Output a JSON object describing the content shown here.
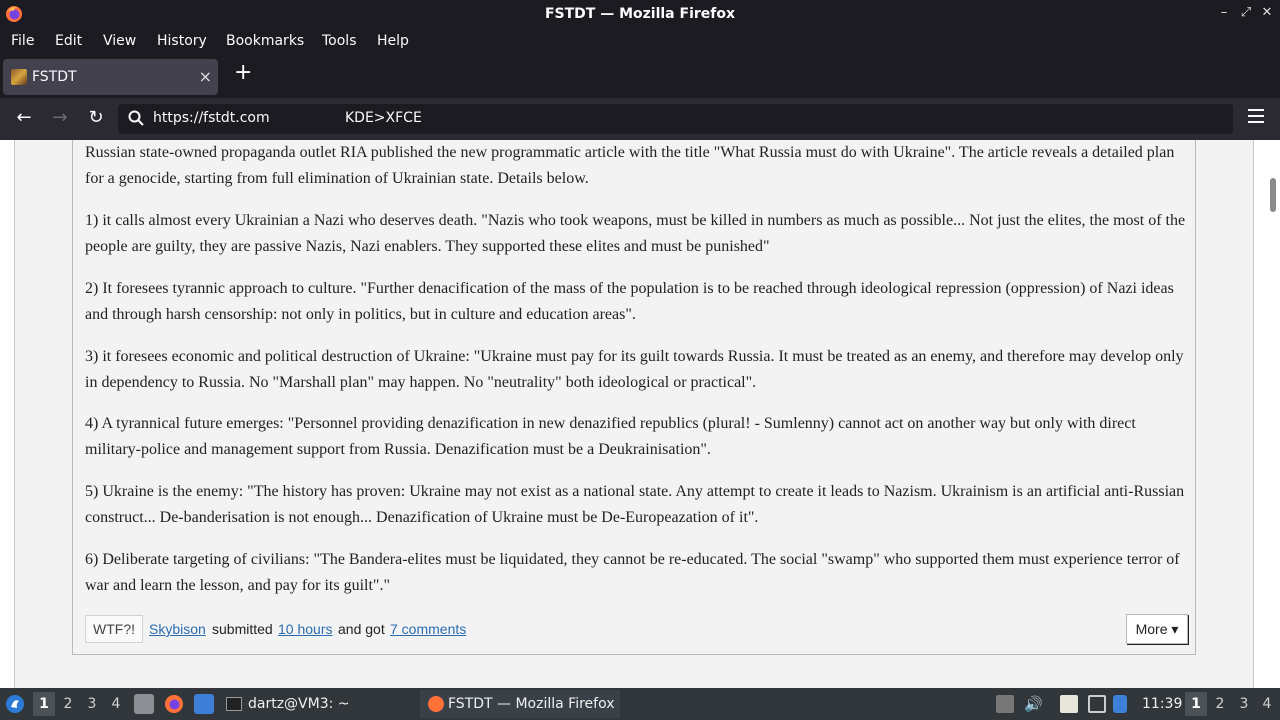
{
  "window": {
    "title": "FSTDT — Mozilla Firefox",
    "controls": {
      "minimize": "–",
      "maximize": "⤢",
      "close": "✕"
    }
  },
  "menu": {
    "file": "File",
    "edit": "Edit",
    "view": "View",
    "history": "History",
    "bookmarks": "Bookmarks",
    "tools": "Tools",
    "help": "Help"
  },
  "tabs": [
    {
      "label": "FSTDT",
      "close": "×"
    }
  ],
  "newtab": "+",
  "nav": {
    "back": "←",
    "forward": "→",
    "reload": "↻",
    "url": "https://fstdt.com",
    "url_extra": "KDE>XFCE"
  },
  "post": {
    "paragraphs": [
      "Russian state-owned propaganda outlet RIA published the new programmatic article with the title \"What Russia must do with Ukraine\". The article reveals a detailed plan for a genocide, starting from full elimination of Ukrainian state. Details below.",
      "1) it calls almost every Ukrainian a Nazi who deserves death. \"Nazis who took weapons, must be killed in numbers as much as possible... Not just the elites, the most of the people are guilty, they are passive Nazis, Nazi enablers. They supported these elites and must be punished\"",
      "2) It foresees tyrannic approach to culture. \"Further denacification of the mass of the population is to be reached through ideological repression (oppression) of Nazi ideas and through harsh censorship: not only in politics, but in culture and education areas\".",
      "3) it foresees economic and political destruction of Ukraine: \"Ukraine must pay for its guilt towards Russia. It must be treated as an enemy, and therefore may develop only in dependency to Russia. No \"Marshall plan\" may happen. No \"neutrality\" both ideological or practical\".",
      "4) A tyrannical future emerges: \"Personnel providing denazification in new denazified republics (plural! - Sumlenny) cannot act on another way but only with direct military-police and management support from Russia. Denazification must be a Deukrainisation\".",
      "5) Ukraine is the enemy: \"The history has proven: Ukraine may not exist as a national state. Any attempt to create it leads to Nazism. Ukrainism is an artificial anti-Russian construct... De-banderisation is not enough... Denazification of Ukraine must be De-Europeazation of it\".",
      "6) Deliberate targeting of civilians: \"The Bandera-elites must be liquidated, they cannot be re-educated. The social \"swamp\" who supported them must experience terror of war and learn the lesson, and pay for its guilt\".\""
    ],
    "footer": {
      "wtf": "WTF?!",
      "user": "Skybison",
      "submitted": "submitted",
      "time": "10 hours",
      "and_got": "and got",
      "comments": "7 comments",
      "more": "More ▾"
    }
  },
  "taskbar": {
    "workspaces_left": [
      "1",
      "2",
      "3",
      "4"
    ],
    "terminal_task": "dartz@VM3: ~",
    "firefox_task": "FSTDT — Mozilla Firefox",
    "clock": "11:39",
    "workspaces_right": [
      "1",
      "2",
      "3",
      "4"
    ]
  }
}
